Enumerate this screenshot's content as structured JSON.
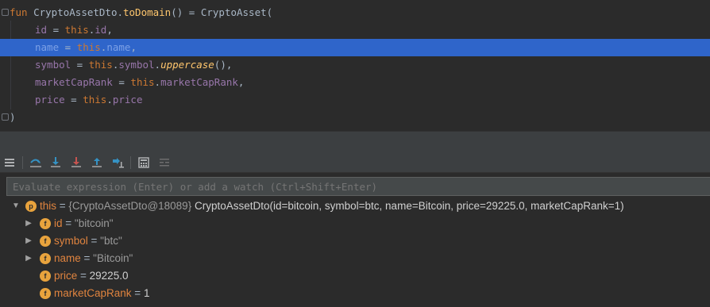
{
  "editor": {
    "lines": [
      {
        "id": "l1",
        "parts": [
          [
            "kw",
            "fun "
          ],
          [
            "plain",
            "CryptoAssetDto."
          ],
          [
            "fn",
            "toDomain"
          ],
          [
            "plain",
            "() = CryptoAsset("
          ]
        ]
      },
      {
        "id": "l2",
        "parts": [
          [
            "prop",
            "id"
          ],
          [
            "plain",
            " = "
          ],
          [
            "kw",
            "this"
          ],
          [
            "plain",
            "."
          ],
          [
            "prop",
            "id"
          ],
          [
            "plain",
            ","
          ]
        ]
      },
      {
        "id": "l3",
        "parts": [
          [
            "prop",
            "name"
          ],
          [
            "plain",
            " = "
          ],
          [
            "kw",
            "this"
          ],
          [
            "plain",
            "."
          ],
          [
            "prop",
            "name"
          ],
          [
            "plain",
            ","
          ]
        ]
      },
      {
        "id": "l4",
        "parts": [
          [
            "prop",
            "symbol"
          ],
          [
            "plain",
            " = "
          ],
          [
            "kw",
            "this"
          ],
          [
            "plain",
            "."
          ],
          [
            "prop",
            "symbol"
          ],
          [
            "plain",
            "."
          ],
          [
            "ital",
            "uppercase"
          ],
          [
            "plain",
            "(),"
          ]
        ]
      },
      {
        "id": "l5",
        "parts": [
          [
            "prop",
            "marketCapRank"
          ],
          [
            "plain",
            " = "
          ],
          [
            "kw",
            "this"
          ],
          [
            "plain",
            "."
          ],
          [
            "prop",
            "marketCapRank"
          ],
          [
            "plain",
            ","
          ]
        ]
      },
      {
        "id": "l6",
        "parts": [
          [
            "prop",
            "price"
          ],
          [
            "plain",
            " = "
          ],
          [
            "kw",
            "this"
          ],
          [
            "plain",
            "."
          ],
          [
            "prop",
            "price"
          ]
        ]
      },
      {
        "id": "l7",
        "parts": [
          [
            "plain",
            ")"
          ]
        ]
      }
    ],
    "selected_line": 3
  },
  "toolbar": {
    "buttons": [
      {
        "name": "frames-menu-icon",
        "color": "#afb1b3"
      },
      {
        "name": "step-over-icon",
        "color": "#3592c4"
      },
      {
        "name": "step-into-icon",
        "color": "#3592c4"
      },
      {
        "name": "force-step-into-icon",
        "color": "#c75450"
      },
      {
        "name": "step-out-icon",
        "color": "#3592c4"
      },
      {
        "name": "run-to-cursor-icon",
        "color": "#3592c4"
      },
      {
        "name": "evaluate-expression-icon",
        "color": "#afb1b3"
      },
      {
        "name": "trace-stream-icon",
        "color": "#6e6e6e"
      }
    ]
  },
  "evaluate": {
    "placeholder": "Evaluate expression (Enter) or add a watch (Ctrl+Shift+Enter)"
  },
  "variables": {
    "root": {
      "badge": "p",
      "name": "this",
      "eq": " = ",
      "ref": "{CryptoAssetDto@18089}",
      "text": " CryptoAssetDto(id=bitcoin, symbol=btc, name=Bitcoin, price=29225.0, marketCapRank=1)"
    },
    "fields": [
      {
        "badge": "f",
        "name": "id",
        "eq": " = ",
        "value": "\"bitcoin\"",
        "kind": "str",
        "expandable": true
      },
      {
        "badge": "f",
        "name": "symbol",
        "eq": " = ",
        "value": "\"btc\"",
        "kind": "str",
        "expandable": true
      },
      {
        "badge": "f",
        "name": "name",
        "eq": " = ",
        "value": "\"Bitcoin\"",
        "kind": "str",
        "expandable": true
      },
      {
        "badge": "f",
        "name": "price",
        "eq": " = ",
        "value": "29225.0",
        "kind": "num",
        "expandable": false
      },
      {
        "badge": "f",
        "name": "marketCapRank",
        "eq": " = ",
        "value": "1",
        "kind": "num",
        "expandable": false
      }
    ]
  }
}
